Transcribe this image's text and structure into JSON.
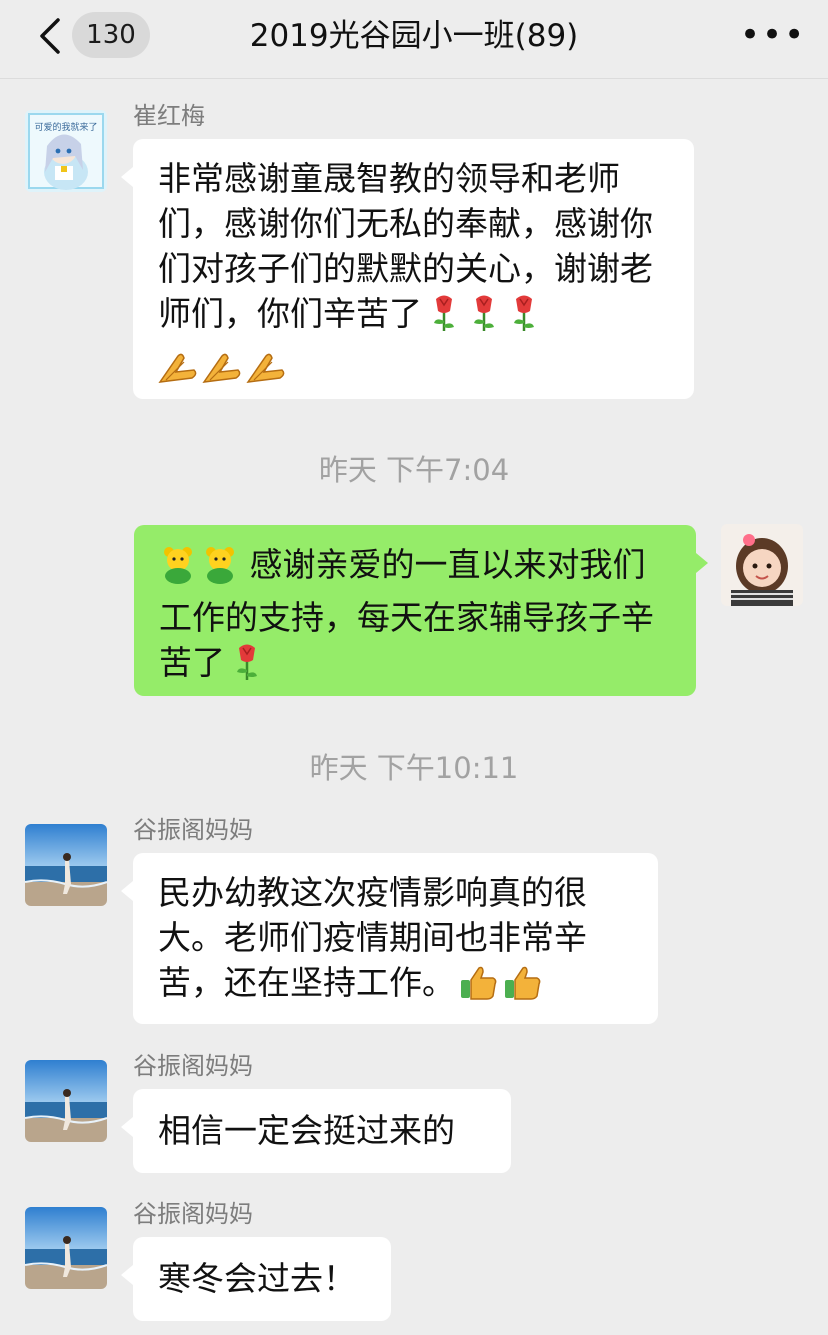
{
  "header": {
    "back_icon": "chevron-left-icon",
    "unread_count": "130",
    "title": "2019光谷园小一班(89)",
    "more_icon": "more-dots-icon",
    "more_label": "•••"
  },
  "messages": [
    {
      "sender": "崔红梅",
      "avatar": "anime-girl-avatar",
      "avatar_caption": "可爱的我就来了",
      "direction": "incoming",
      "text": "非常感谢童晟智教的领导和老师们，感谢你们无私的奉献，感谢你们对孩子们的默默的关心，谢谢老师们，你们辛苦了",
      "emojis_inline": [
        "rose",
        "rose",
        "rose"
      ],
      "emojis_after": [
        "clap",
        "clap",
        "clap"
      ]
    },
    {
      "timestamp": "昨天 下午7:04"
    },
    {
      "sender": "",
      "avatar": "little-girl-avatar",
      "direction": "outgoing",
      "emojis_before": [
        "bear",
        "bear"
      ],
      "text": "感谢亲爱的一直以来对我们工作的支持，每天在家辅导孩子辛苦了",
      "emojis_inline": [
        "rose"
      ]
    },
    {
      "timestamp": "昨天 下午10:11"
    },
    {
      "sender": "谷振阁妈妈",
      "avatar": "beach-avatar",
      "direction": "incoming",
      "text": "民办幼教这次疫情影响真的很大。老师们疫情期间也非常辛苦，还在坚持工作。",
      "emojis_inline": [
        "thumbs-up",
        "thumbs-up"
      ]
    },
    {
      "sender": "谷振阁妈妈",
      "avatar": "beach-avatar",
      "direction": "incoming",
      "text": "相信一定会挺过来的"
    },
    {
      "sender": "谷振阁妈妈",
      "avatar": "beach-avatar",
      "direction": "incoming",
      "text": "寒冬会过去！"
    }
  ],
  "colors": {
    "background": "#ededed",
    "incoming_bubble": "#ffffff",
    "outgoing_bubble": "#95ec69",
    "timestamp_text": "#a2a2a2",
    "sender_text": "#7d7d7d"
  }
}
